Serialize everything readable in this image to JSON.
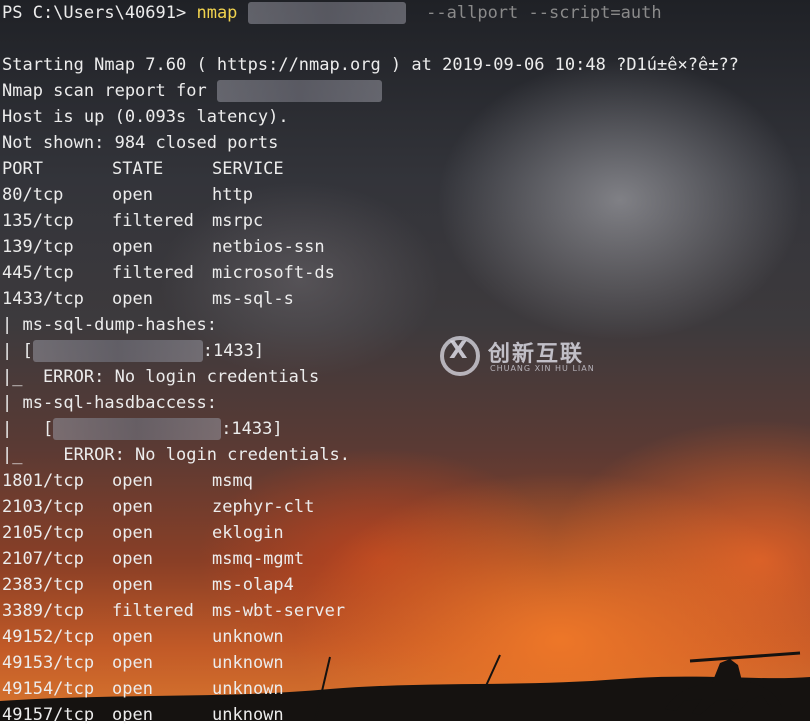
{
  "prompt": {
    "ps": "PS C:\\Users\\40691> ",
    "command": "nmap",
    "args": "--allport --script=auth"
  },
  "output": {
    "starting": "Starting Nmap 7.60 ( https://nmap.org ) at 2019-09-06 10:48 ?D1ú±ê×?ê±??",
    "scan_report": "Nmap scan report for ",
    "host_up": "Host is up (0.093s latency).",
    "not_shown": "Not shown: 984 closed ports"
  },
  "table": {
    "headers": [
      "PORT",
      "STATE",
      "SERVICE"
    ],
    "rows_a": [
      {
        "port": "80/tcp",
        "state": "open",
        "service": "http"
      },
      {
        "port": "135/tcp",
        "state": "filtered",
        "service": "msrpc"
      },
      {
        "port": "139/tcp",
        "state": "open",
        "service": "netbios-ssn"
      },
      {
        "port": "445/tcp",
        "state": "filtered",
        "service": "microsoft-ds"
      },
      {
        "port": "1433/tcp",
        "state": "open",
        "service": "ms-sql-s"
      }
    ],
    "rows_b": [
      {
        "port": "1801/tcp",
        "state": "open",
        "service": "msmq"
      },
      {
        "port": "2103/tcp",
        "state": "open",
        "service": "zephyr-clt"
      },
      {
        "port": "2105/tcp",
        "state": "open",
        "service": "eklogin"
      },
      {
        "port": "2107/tcp",
        "state": "open",
        "service": "msmq-mgmt"
      },
      {
        "port": "2383/tcp",
        "state": "open",
        "service": "ms-olap4"
      },
      {
        "port": "3389/tcp",
        "state": "filtered",
        "service": "ms-wbt-server"
      },
      {
        "port": "49152/tcp",
        "state": "open",
        "service": "unknown"
      },
      {
        "port": "49153/tcp",
        "state": "open",
        "service": "unknown"
      },
      {
        "port": "49154/tcp",
        "state": "open",
        "service": "unknown"
      },
      {
        "port": "49157/tcp",
        "state": "open",
        "service": "unknown"
      }
    ]
  },
  "script": {
    "dump_title": "| ms-sql-dump-hashes:",
    "dump_target_prefix": "| [",
    "dump_target_suffix": ":1433]",
    "dump_error": "|_  ERROR: No login credentials",
    "access_title": "| ms-sql-hasdbaccess:",
    "access_target_prefix": "|   [",
    "access_target_suffix": ":1433]",
    "access_error": "|_    ERROR: No login credentials."
  },
  "watermark": {
    "logo": "X",
    "chinese": "创新互联",
    "english": "CHUANG XIN HU LIAN"
  },
  "colors": {
    "text": "#ececec",
    "command": "#f1d34e",
    "args": "#8a8a8a"
  }
}
